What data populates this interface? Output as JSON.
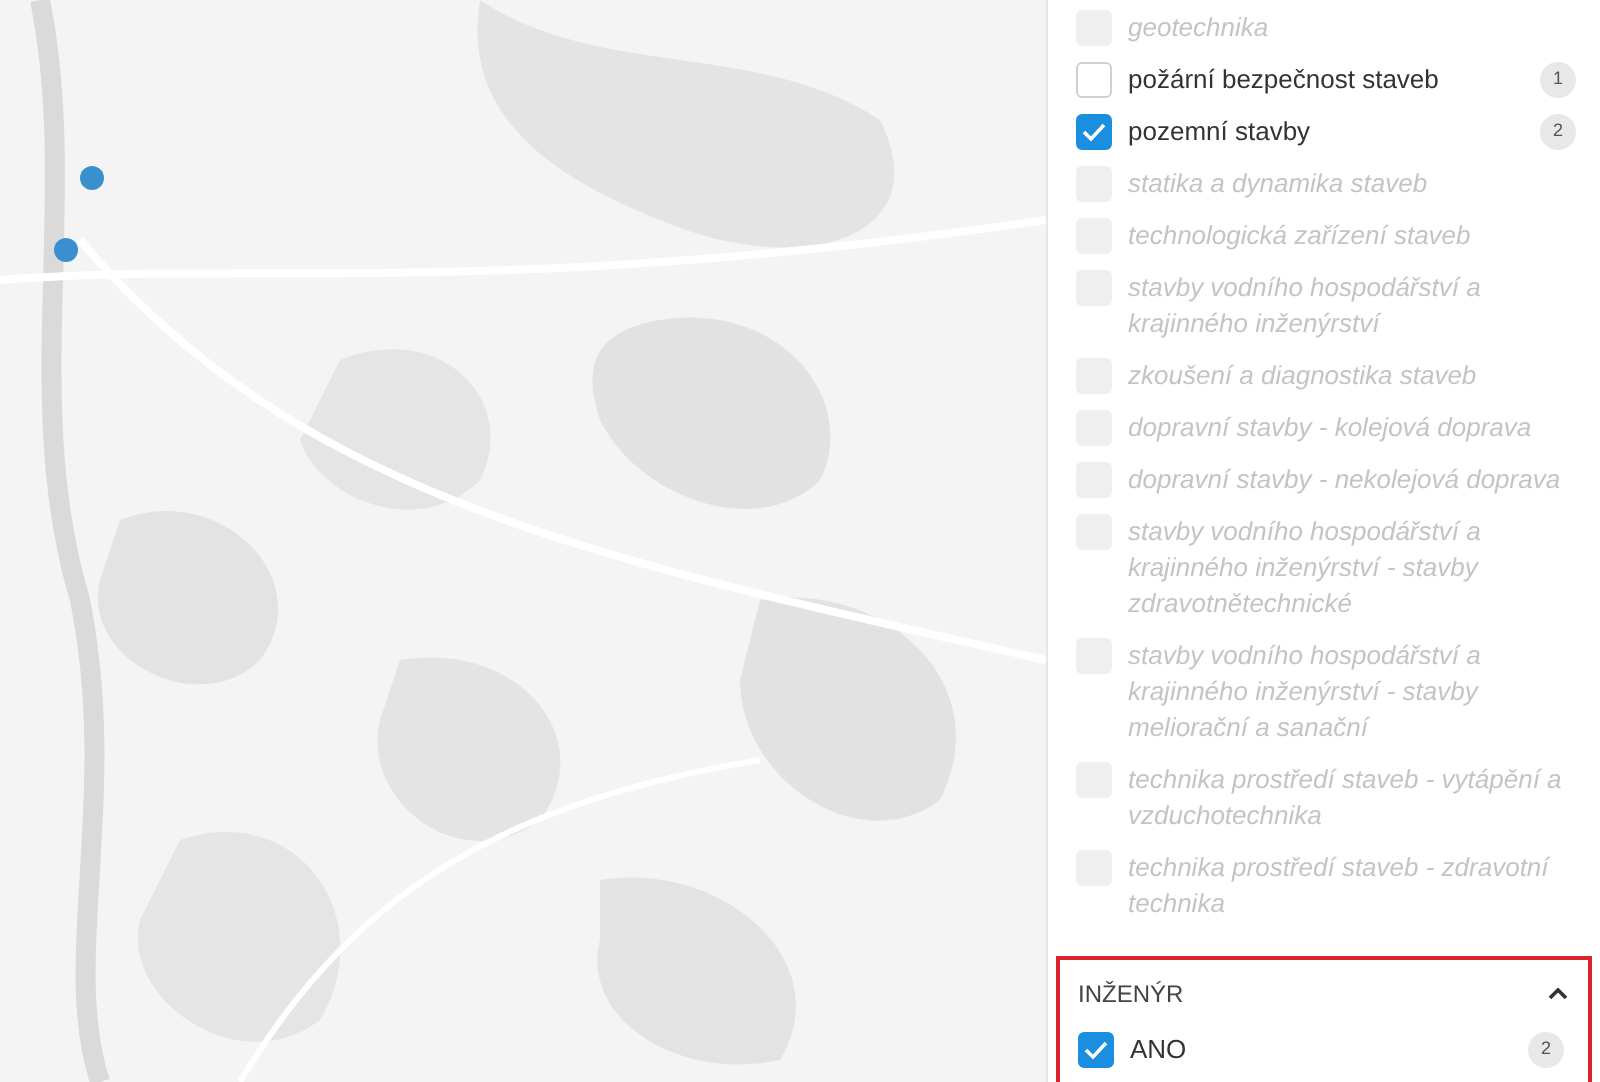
{
  "map": {
    "kind": "picture",
    "markers": [
      {
        "kind": "pin"
      },
      {
        "kind": "pin"
      }
    ]
  },
  "filters": [
    {
      "label": "geotechnika",
      "checked": false,
      "disabled": true
    },
    {
      "label": "požární bezpečnost staveb",
      "checked": false,
      "disabled": false,
      "count": "1"
    },
    {
      "label": "pozemní stavby",
      "checked": true,
      "disabled": false,
      "count": "2"
    },
    {
      "label": "statika a dynamika staveb",
      "checked": false,
      "disabled": true
    },
    {
      "label": "technologická zařízení staveb",
      "checked": false,
      "disabled": true
    },
    {
      "label": "stavby vodního hospodářství a krajinného inženýrství",
      "checked": false,
      "disabled": true
    },
    {
      "label": "zkoušení a diagnostika staveb",
      "checked": false,
      "disabled": true
    },
    {
      "label": "dopravní stavby - kolejová doprava",
      "checked": false,
      "disabled": true
    },
    {
      "label": "dopravní stavby - nekolejová doprava",
      "checked": false,
      "disabled": true
    },
    {
      "label": "stavby vodního hospodářství a krajinného inženýrství - stavby zdravotnětechnické",
      "checked": false,
      "disabled": true
    },
    {
      "label": "stavby vodního hospodářství a krajinného inženýrství - stavby meliorační a sanační",
      "checked": false,
      "disabled": true
    },
    {
      "label": "technika prostředí staveb - vytápění a vzduchotechnika",
      "checked": false,
      "disabled": true
    },
    {
      "label": "technika prostředí staveb - zdravotní technika",
      "checked": false,
      "disabled": true
    }
  ],
  "section": {
    "title": "INŽENÝR",
    "expanded": true,
    "highlighted": true,
    "items": [
      {
        "label": "ANO",
        "checked": true,
        "disabled": false,
        "count": "2"
      }
    ]
  }
}
